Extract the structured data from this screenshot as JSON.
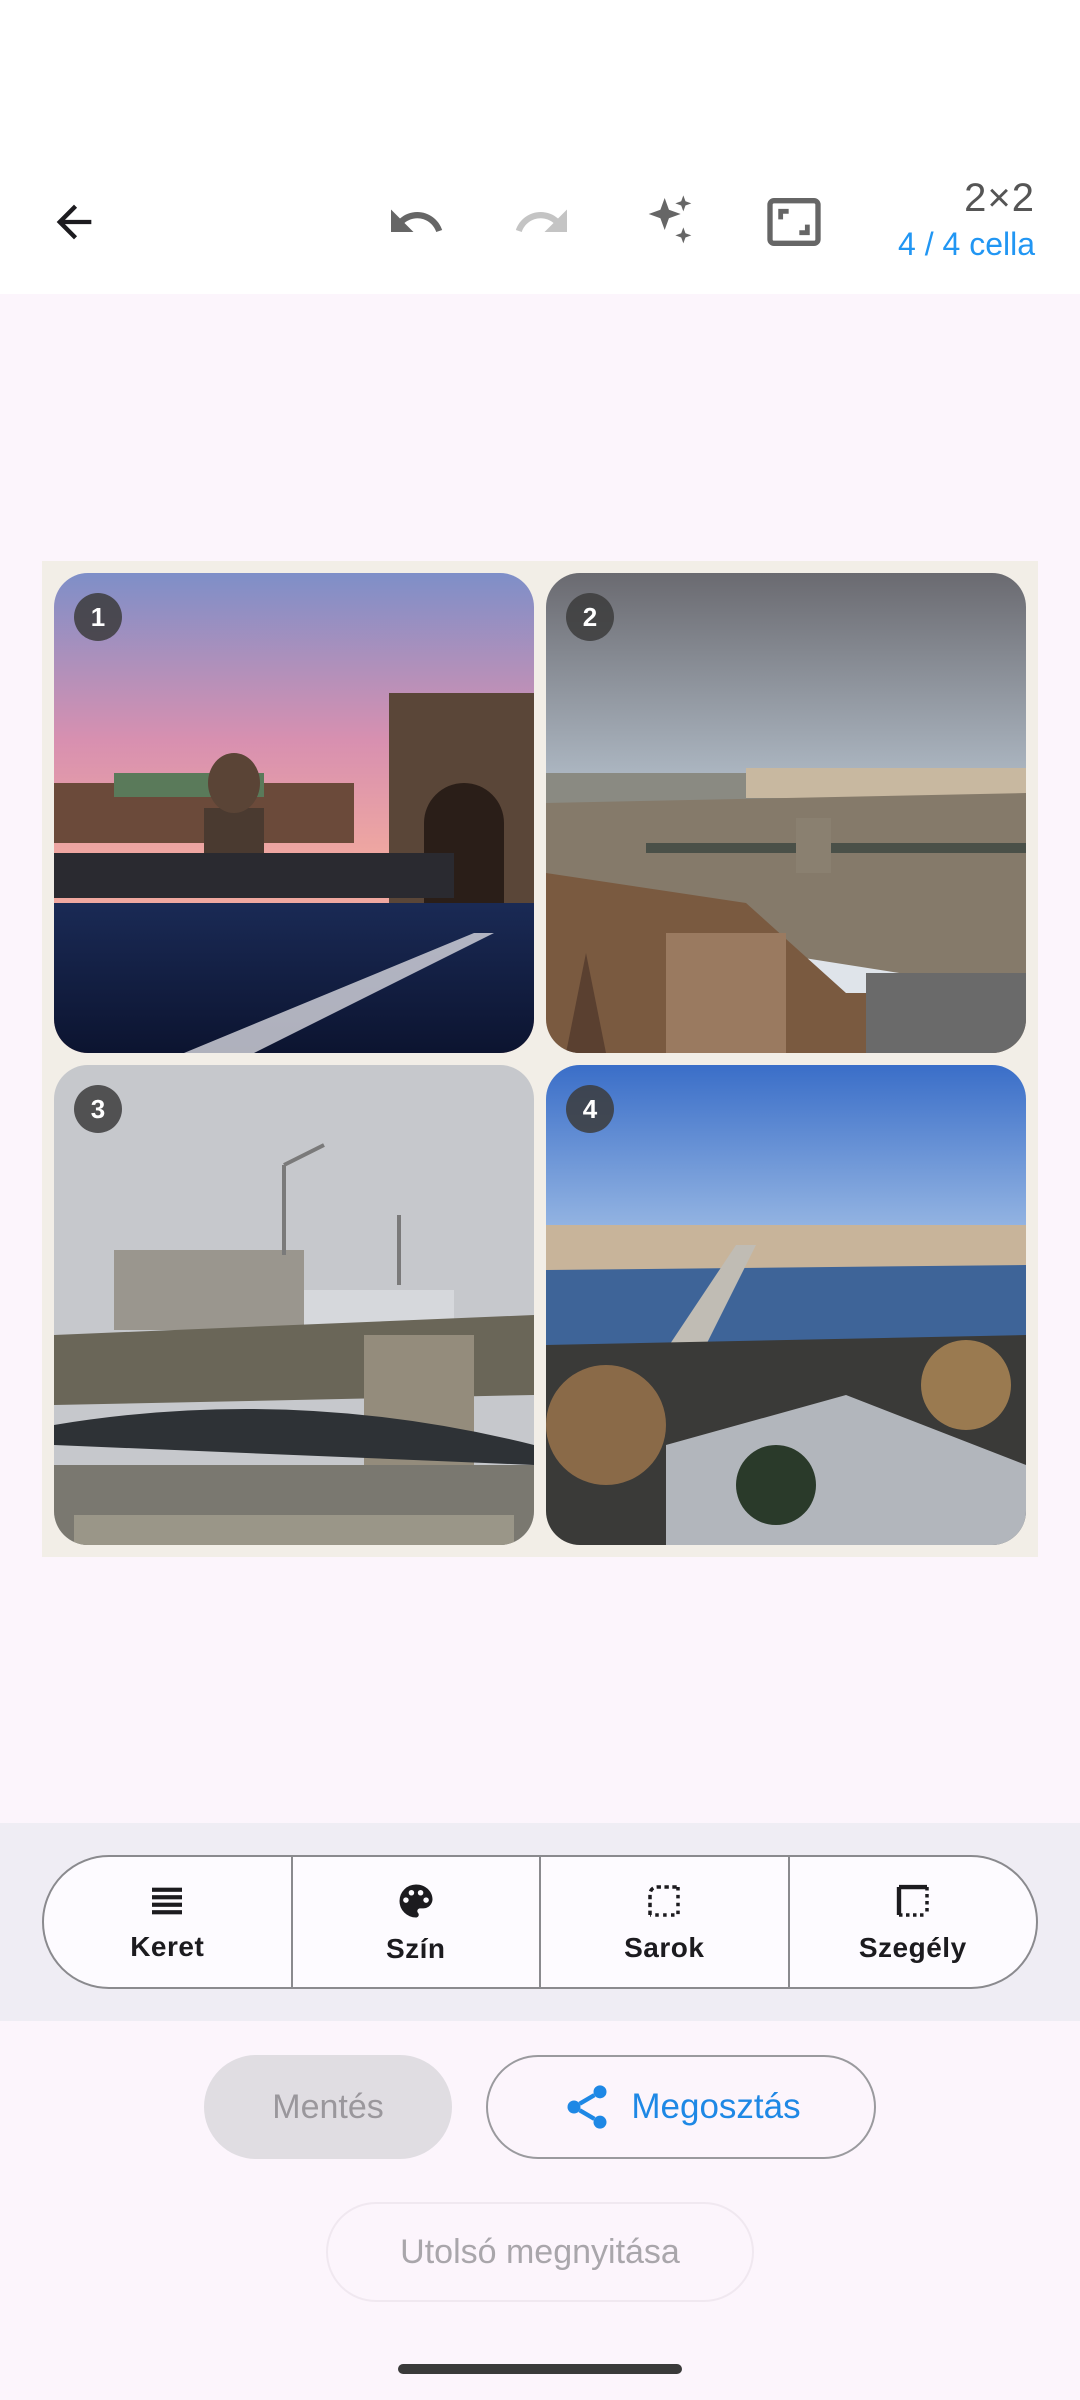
{
  "toolbar": {
    "grid_size": "2×2",
    "cell_count": "4 / 4 cella",
    "icons": [
      "back-arrow-icon",
      "undo-icon",
      "redo-icon",
      "sparkle-icon",
      "aspect-ratio-icon"
    ]
  },
  "cells": [
    {
      "number": "1",
      "description": "chain bridge lion at sunset"
    },
    {
      "number": "2",
      "description": "danube with chain bridge and parliament"
    },
    {
      "number": "3",
      "description": "chain bridge and castle in fog"
    },
    {
      "number": "4",
      "description": "danube view in winter"
    }
  ],
  "tabs": [
    {
      "label": "Keret",
      "icon": "layout-lines-icon"
    },
    {
      "label": "Szín",
      "icon": "palette-icon"
    },
    {
      "label": "Sarok",
      "icon": "corner-icon"
    },
    {
      "label": "Szegély",
      "icon": "border-icon"
    }
  ],
  "actions": {
    "save_label": "Mentés",
    "share_label": "Megosztás",
    "open_last_label": "Utolsó megnyitása"
  },
  "colors": {
    "accent": "#2196f3",
    "background": "#fcf5fc",
    "canvas": "#f2eee7"
  }
}
